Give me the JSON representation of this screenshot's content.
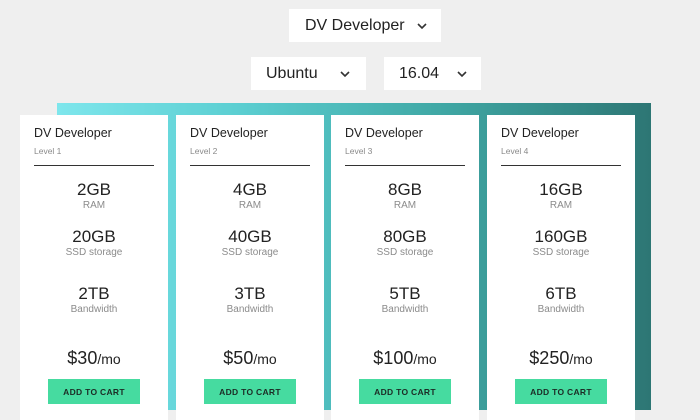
{
  "selectors": {
    "plan": "DV Developer",
    "os": "Ubuntu",
    "version": "16.04"
  },
  "colors": {
    "band_start": "#7ee6ec",
    "band_end": "#2d7674",
    "cart_button": "#46dba0"
  },
  "cards": [
    {
      "name": "DV Developer",
      "level": "Level 1",
      "ram": "2GB",
      "ram_label": "RAM",
      "ssd": "20GB",
      "ssd_label": "SSD storage",
      "bandwidth": "2TB",
      "bandwidth_label": "Bandwidth",
      "price": "$30",
      "per": "/mo",
      "cart": "ADD TO CART"
    },
    {
      "name": "DV Developer",
      "level": "Level 2",
      "ram": "4GB",
      "ram_label": "RAM",
      "ssd": "40GB",
      "ssd_label": "SSD storage",
      "bandwidth": "3TB",
      "bandwidth_label": "Bandwidth",
      "price": "$50",
      "per": "/mo",
      "cart": "ADD TO CART"
    },
    {
      "name": "DV Developer",
      "level": "Level 3",
      "ram": "8GB",
      "ram_label": "RAM",
      "ssd": "80GB",
      "ssd_label": "SSD storage",
      "bandwidth": "5TB",
      "bandwidth_label": "Bandwidth",
      "price": "$100",
      "per": "/mo",
      "cart": "ADD TO CART"
    },
    {
      "name": "DV Developer",
      "level": "Level 4",
      "ram": "16GB",
      "ram_label": "RAM",
      "ssd": "160GB",
      "ssd_label": "SSD storage",
      "bandwidth": "6TB",
      "bandwidth_label": "Bandwidth",
      "price": "$250",
      "per": "/mo",
      "cart": "ADD TO CART"
    }
  ]
}
